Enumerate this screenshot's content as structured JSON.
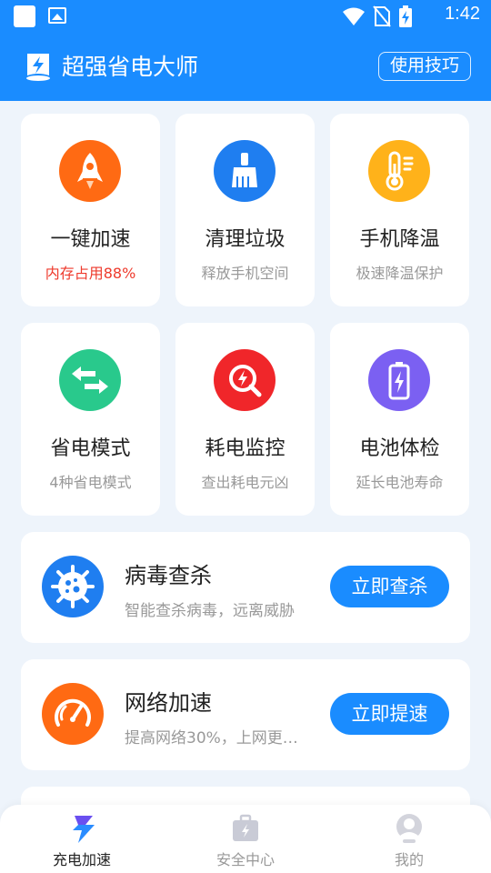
{
  "status_bar": {
    "time": "1:42",
    "icons": [
      "app-square-icon",
      "image-icon",
      "wifi-icon",
      "no-sim-icon",
      "battery-charging-icon"
    ]
  },
  "header": {
    "title": "超强省电大师",
    "tips_button": "使用技巧",
    "logo_icon": "power-save-logo-icon"
  },
  "tiles": [
    {
      "title": "一键加速",
      "subtitle": "内存占用88%",
      "icon": "rocket-icon",
      "color": "#ff6a13"
    },
    {
      "title": "清理垃圾",
      "subtitle": "释放手机空间",
      "icon": "broom-icon",
      "color": "#1f7ef0"
    },
    {
      "title": "手机降温",
      "subtitle": "极速降温保护",
      "icon": "thermometer-icon",
      "color": "#ffb21a"
    },
    {
      "title": "省电模式",
      "subtitle": "4种省电模式",
      "icon": "swap-arrows-icon",
      "color": "#29c98c"
    },
    {
      "title": "耗电监控",
      "subtitle": "查出耗电元凶",
      "icon": "power-search-icon",
      "color": "#f0262a"
    },
    {
      "title": "电池体检",
      "subtitle": "延长电池寿命",
      "icon": "battery-icon",
      "color": "#7b60f2"
    }
  ],
  "features": [
    {
      "title": "病毒查杀",
      "subtitle": "智能查杀病毒，远离威胁",
      "button": "立即查杀",
      "icon": "virus-icon",
      "color": "#1f7ef0"
    },
    {
      "title": "网络加速",
      "subtitle": "提高网络30%，上网更…",
      "button": "立即提速",
      "icon": "speedometer-icon",
      "color": "#ff6a13"
    }
  ],
  "bottom_nav": [
    {
      "label": "充电加速",
      "icon": "charge-icon",
      "active": true
    },
    {
      "label": "安全中心",
      "icon": "toolbox-icon",
      "active": false
    },
    {
      "label": "我的",
      "icon": "profile-icon",
      "active": false
    }
  ],
  "colors": {
    "primary": "#1a8cff",
    "background": "#eef4fb",
    "warning_text": "#ee3a2c"
  }
}
